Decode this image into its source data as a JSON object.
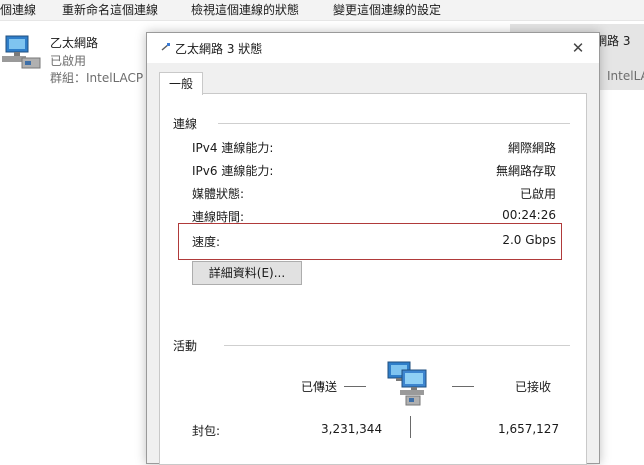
{
  "explorer": {
    "commands": [
      "個連線",
      "重新命名這個連線",
      "檢視這個連線的狀態",
      "變更這個連線的設定"
    ],
    "adapter_left": {
      "name": "乙太網路",
      "status": "已啟用",
      "group": "群組：IntelLACP"
    },
    "adapter_right": {
      "name": "網路 3",
      "group": "：IntelLAC"
    }
  },
  "dialog": {
    "title": "乙太網路 3 狀態",
    "close_glyph": "✕",
    "tab_general": "一般",
    "connection": {
      "heading": "連線",
      "ipv4_label": "IPv4 連線能力:",
      "ipv4_value": "網際網路",
      "ipv6_label": "IPv6 連線能力:",
      "ipv6_value": "無網路存取",
      "media_label": "媒體狀態:",
      "media_value": "已啟用",
      "duration_label": "連線時間:",
      "duration_value": "00:24:26",
      "speed_label": "速度:",
      "speed_value": "2.0 Gbps"
    },
    "details_button": "詳細資料(E)...",
    "activity": {
      "heading": "活動",
      "sent_label": "已傳送",
      "received_label": "已接收",
      "packets_label": "封包:",
      "packets_sent": "3,231,344",
      "packets_received": "1,657,127"
    }
  },
  "colors": {
    "highlight_box": "#b03a3a",
    "dialog_bg": "#f0f0f0",
    "panel_bg": "#ffffff"
  },
  "icons": [
    "network-adapter-icon",
    "network-connection-icon",
    "close-icon",
    "network-activity-icon"
  ]
}
